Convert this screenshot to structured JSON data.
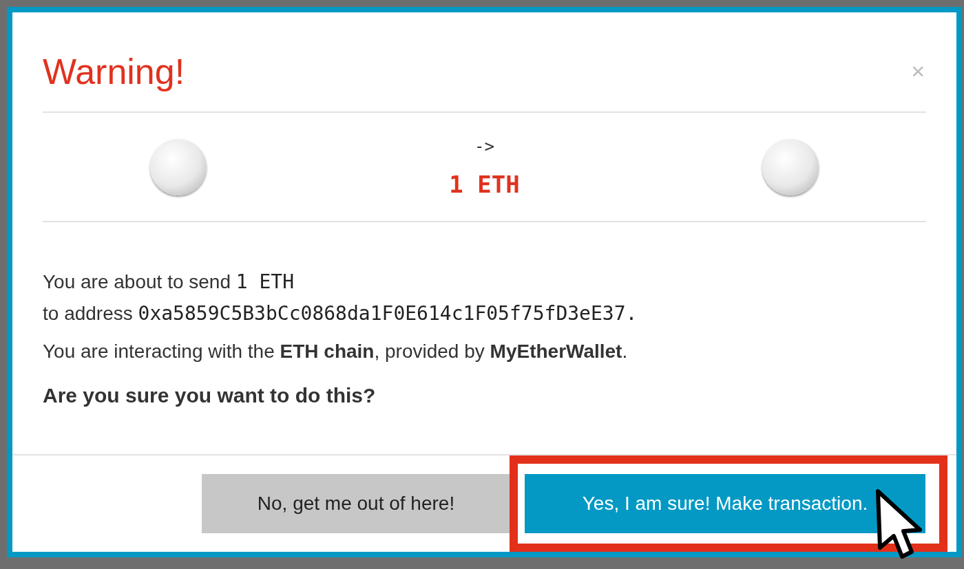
{
  "dialog": {
    "title": "Warning!",
    "close": "×",
    "arrow": "->",
    "amount": "1 ETH",
    "message_lines": [
      {
        "prefix": "You are about to send ",
        "value": "1 ETH"
      },
      {
        "prefix": "to address ",
        "value": "0xa5859C5B3bCc0868da1F0E614c1F05f75fD3eE37."
      }
    ],
    "chain_note": "You are interacting with the **ETH chain**, provided by **MyEtherWallet**.",
    "question": "Are you sure you want to do this?",
    "buttons": [
      {
        "label": "No, get me out of here!",
        "kind": "cancel",
        "highlighted": false
      },
      {
        "label": "Yes, I am sure! Make transaction.",
        "kind": "confirm",
        "highlighted": true
      }
    ]
  }
}
